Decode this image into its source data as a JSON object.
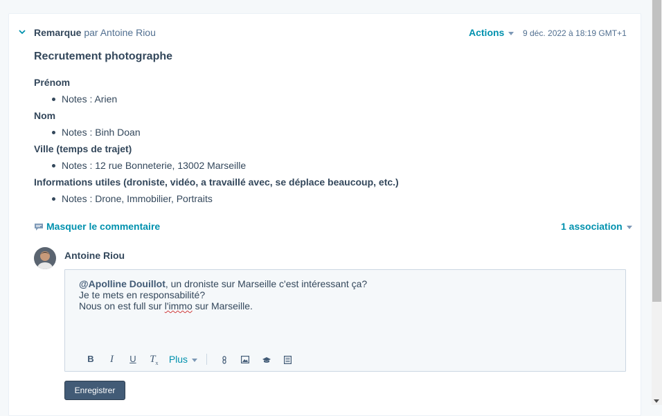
{
  "note": {
    "type": "Remarque",
    "by_text": "par Antoine Riou",
    "actions_label": "Actions",
    "timestamp": "9 déc. 2022 à 18:19 GMT+1",
    "title": "Recrutement photographe",
    "fields": [
      {
        "label": "Prénom",
        "note": "Notes : Arien"
      },
      {
        "label": "Nom",
        "note": "Notes : Binh Doan"
      },
      {
        "label": "Ville (temps de trajet)",
        "note": "Notes : 12 rue Bonneterie, 13002 Marseille"
      },
      {
        "label": "Informations utiles (droniste, vidéo, a travaillé avec, se déplace beaucoup, etc.)",
        "note": "Notes : Drone, Immobilier, Portraits"
      }
    ]
  },
  "comments": {
    "toggle_label": "Masquer le commentaire",
    "association_label": "1 association"
  },
  "comment_editor": {
    "author": "Antoine Riou",
    "mention": "@Apolline Douillot",
    "line1_rest": ", un droniste sur Marseille c'est intéressant ça?",
    "line2": "Je te mets en responsabilité?",
    "line3_a": "Nous on est full sur ",
    "line3_misspelled": "l'immo",
    "line3_b": " sur Marseille.",
    "toolbar": {
      "bold": "B",
      "italic": "I",
      "underline": "U",
      "clear_format": "T",
      "more": "Plus"
    },
    "save_label": "Enregistrer"
  },
  "colors": {
    "accent": "#0091ae",
    "text": "#33475b",
    "button": "#425b76",
    "editor_bg": "#f5f8fa"
  },
  "icons": [
    "chevron-down-icon",
    "comment-icon",
    "link-icon",
    "image-icon",
    "knowledge-icon",
    "snippet-icon",
    "clear-format-icon"
  ]
}
